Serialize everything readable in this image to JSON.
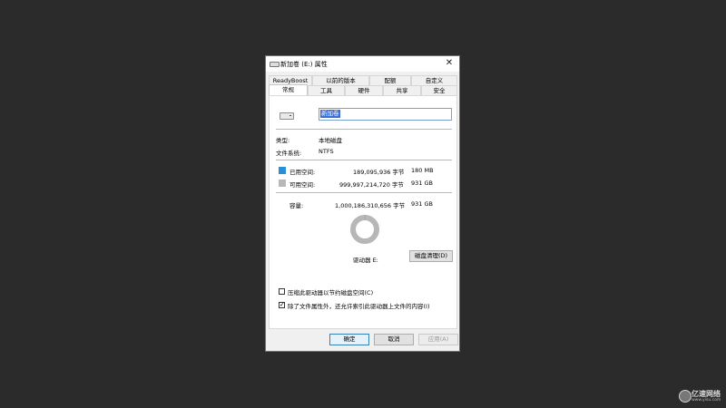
{
  "window": {
    "title": "新加卷 (E:) 属性",
    "close_glyph": "✕"
  },
  "tabs_row1": [
    "ReadyBoost",
    "以前的版本",
    "配额",
    "自定义"
  ],
  "tabs_row2": [
    "常规",
    "工具",
    "硬件",
    "共享",
    "安全"
  ],
  "general": {
    "volume_name_value": "新加卷",
    "type_label": "类型:",
    "type_value": "本地磁盘",
    "fs_label": "文件系统:",
    "fs_value": "NTFS",
    "used_label": "已用空间:",
    "used_bytes": "189,095,936 字节",
    "used_size": "180 MB",
    "free_label": "可用空间:",
    "free_bytes": "999,997,214,720 字节",
    "free_size": "931 GB",
    "capacity_label": "容量:",
    "capacity_bytes": "1,000,186,310,656 字节",
    "capacity_size": "931 GB",
    "drive_label": "驱动器 E:",
    "cleanup_label": "磁盘清理(D)",
    "compress_label": "压缩此驱动器以节约磁盘空间(C)",
    "compress_checked": false,
    "index_label": "除了文件属性外，还允许索引此驱动器上文件的内容(I)",
    "index_checked": true
  },
  "usage": {
    "used_fraction": 0.00019,
    "used_color": "#2b8fd6",
    "free_color": "#b7b7b7"
  },
  "buttons": {
    "ok": "确定",
    "cancel": "取消",
    "apply": "应用(A)"
  },
  "watermark": {
    "brand": "亿速网络",
    "url": "www.yisu.com"
  }
}
